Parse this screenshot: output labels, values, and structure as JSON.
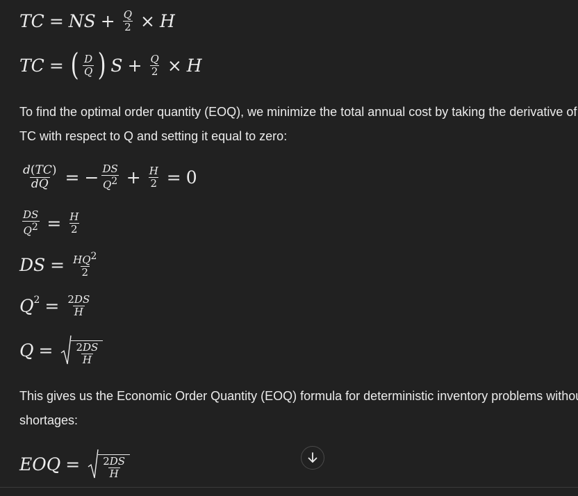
{
  "paragraphs": {
    "p1_line1": "To find the optimal order quantity (EOQ), we minimize the total annual cost by taking the derivative of",
    "p1_line2": "TC with respect to Q and setting it equal to zero:",
    "p2_line1": "This gives us the Economic Order Quantity (EOQ) formula for deterministic inventory problems without",
    "p2_line2": "shortages:"
  },
  "equations": {
    "eq1": "TC = NS + Q/2 × H",
    "eq2": "TC = (D/Q) S + Q/2 × H",
    "eq3": "d(TC)/dQ = − DS/Q² + H/2 = 0",
    "eq4": "DS/Q² = H/2",
    "eq5": "DS = HQ²/2",
    "eq6": "Q² = 2DS/H",
    "eq7": "Q = √(2DS/H)",
    "eq8": "EOQ = √(2DS/H)"
  },
  "controls": {
    "scroll_down_icon": "arrow-down-icon"
  },
  "colors": {
    "background": "#212121",
    "text": "#ececec"
  }
}
